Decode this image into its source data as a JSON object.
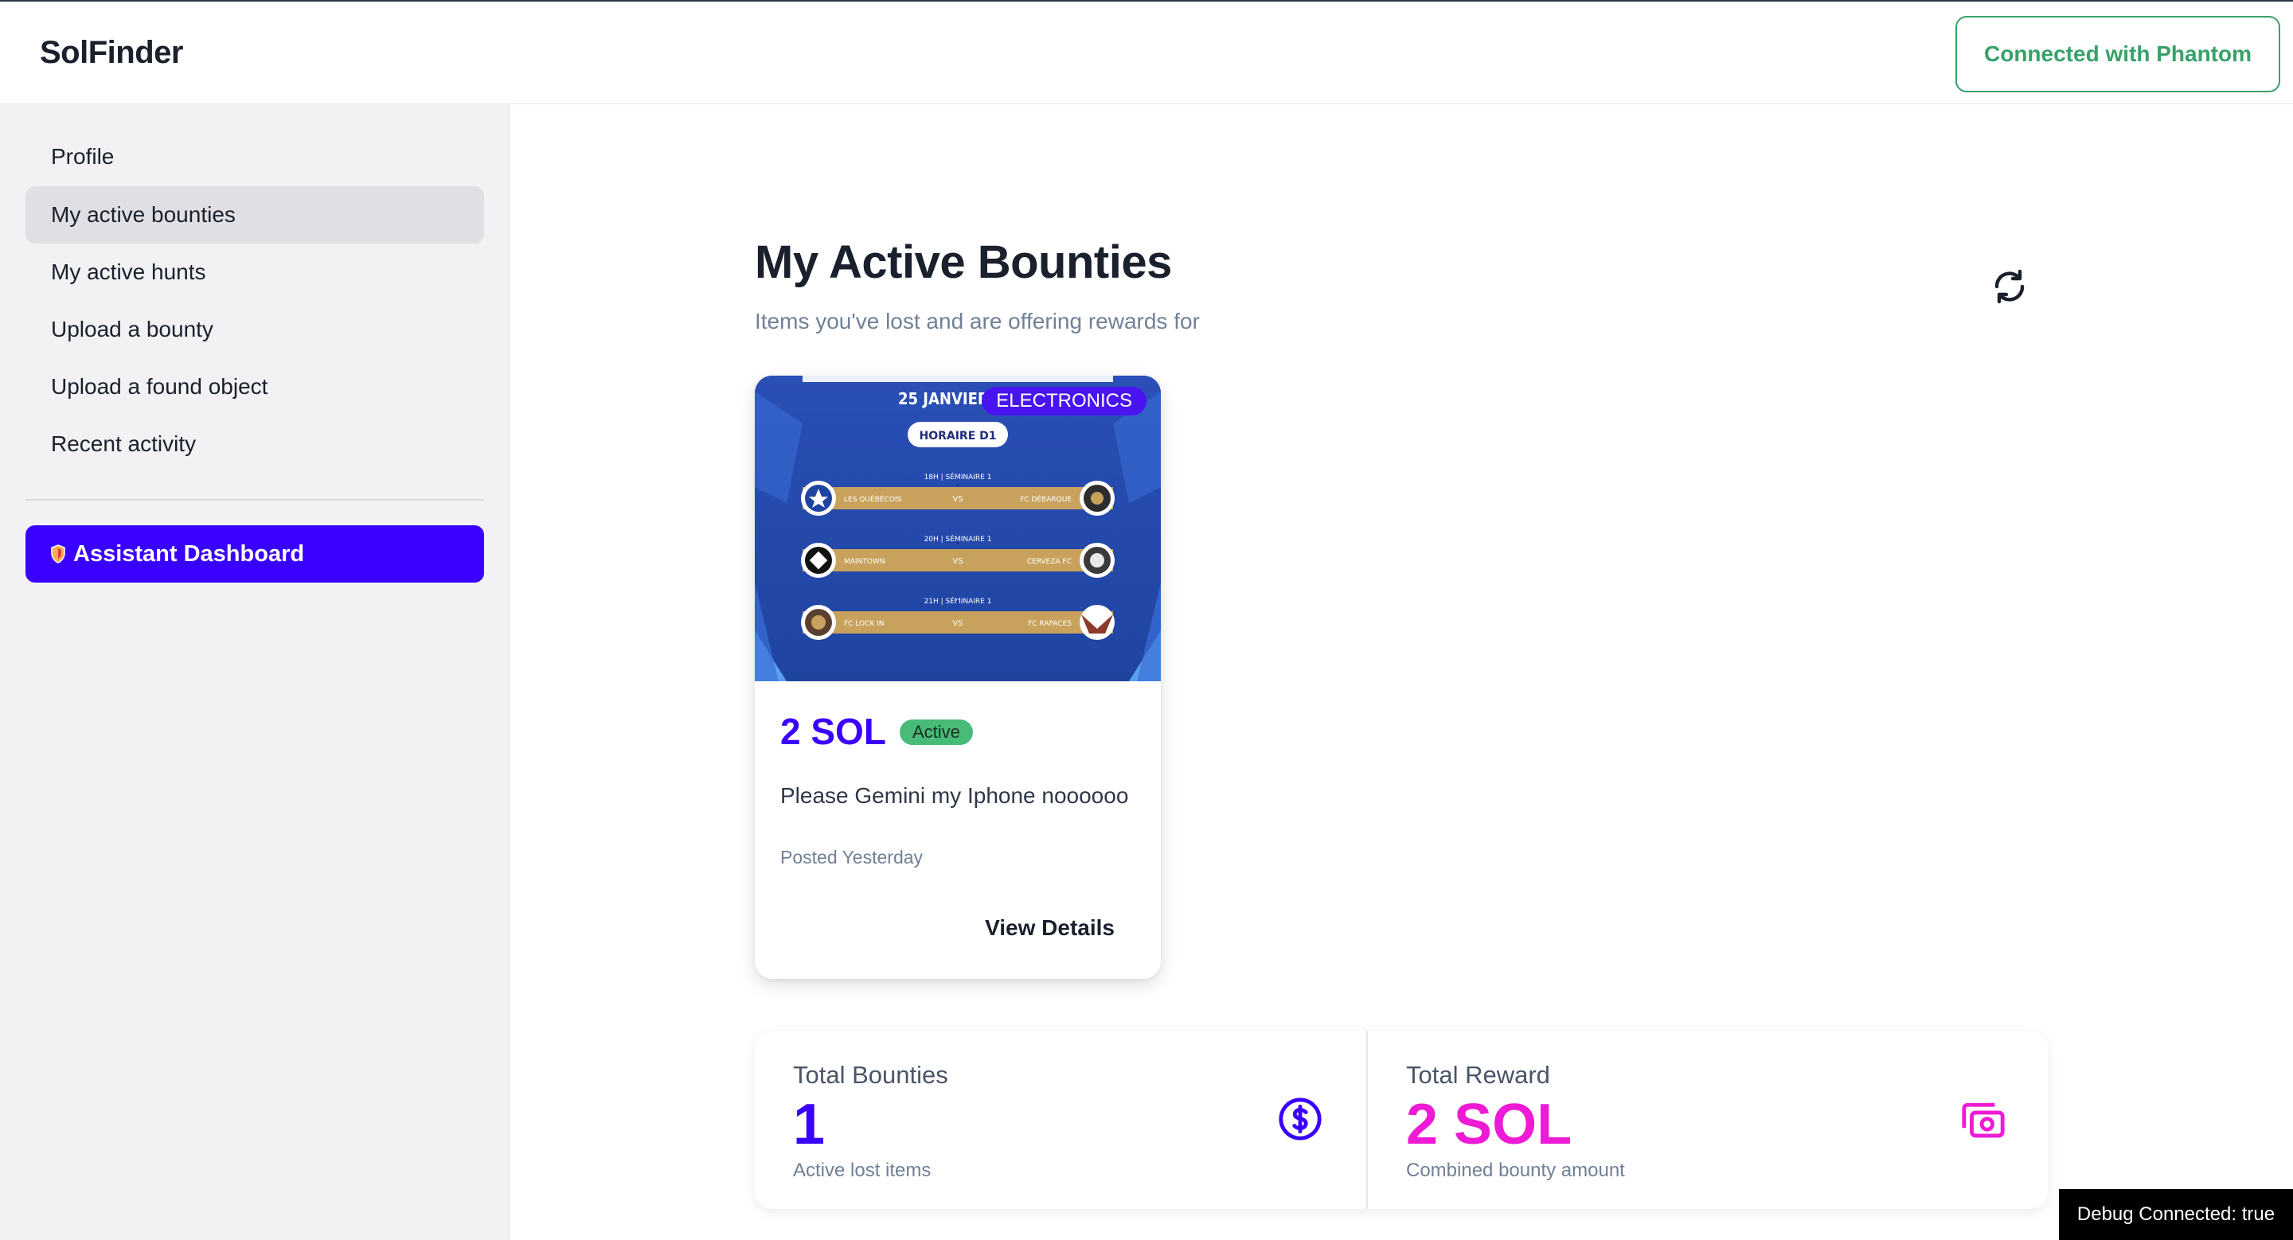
{
  "app": {
    "brand": "SolFinder",
    "wallet_button": "Connected with Phantom"
  },
  "sidebar": {
    "items": [
      {
        "label": "Profile"
      },
      {
        "label": "My active bounties",
        "active": true
      },
      {
        "label": "My active hunts"
      },
      {
        "label": "Upload a bounty"
      },
      {
        "label": "Upload a found object"
      },
      {
        "label": "Recent activity"
      }
    ],
    "assistant_button": "Assistant Dashboard"
  },
  "main": {
    "title": "My Active Bounties",
    "subtitle": "Items you've lost and are offering rewards for",
    "refresh_icon": "refresh-icon"
  },
  "bounties": [
    {
      "category": "ELECTRONICS",
      "reward": "2 SOL",
      "status": "Active",
      "description": "Please Gemini my Iphone noooooo",
      "posted": "Posted Yesterday",
      "action": "View Details",
      "image": {
        "header": "25 JANVIER 2",
        "banner": "HORAIRE D1",
        "matches": [
          {
            "time": "18H | SÉMINAIRE 1",
            "home": "LES QUÉBÉCOIS",
            "vs": "VS",
            "away": "FC DÉBARQUE"
          },
          {
            "time": "20H | SÉMINAIRE 1",
            "home": "MAINTOWN",
            "vs": "VS",
            "away": "CERVEZA FC"
          },
          {
            "time": "21H | SÉMINAIRE 1",
            "home": "FC LOCK IN",
            "vs": "VS",
            "away": "FC RAPACES"
          }
        ]
      }
    }
  ],
  "stats": {
    "total_bounties": {
      "label": "Total Bounties",
      "value": "1",
      "sub": "Active lost items",
      "icon": "dollar-circle-icon",
      "color": "#3a00ff"
    },
    "total_reward": {
      "label": "Total Reward",
      "value": "2 SOL",
      "sub": "Combined bounty amount",
      "icon": "cash-icon",
      "color": "#ee1ad6"
    }
  },
  "debug": "Debug Connected: true",
  "colors": {
    "accent": "#3a00ff",
    "success": "#38a169",
    "pink": "#ee1ad6",
    "sidebar_bg": "#f2f2f4"
  }
}
